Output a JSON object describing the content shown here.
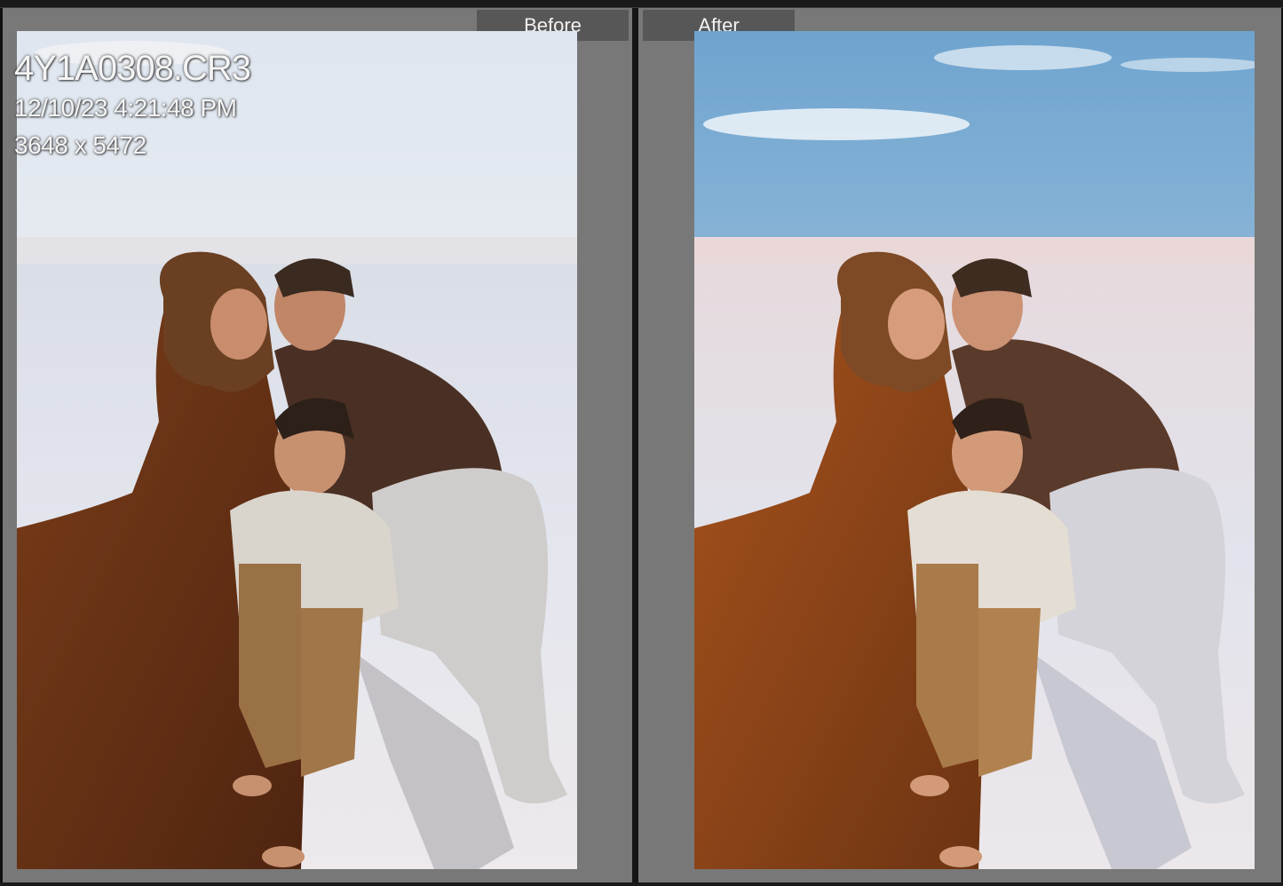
{
  "compare": {
    "before_label": "Before",
    "after_label": "After"
  },
  "photo_info": {
    "filename": "4Y1A0308.CR3",
    "capture_time": "12/10/23 4:21:48 PM",
    "dimensions": "3648 x 5472"
  },
  "colors": {
    "pane_background": "#787878",
    "label_background": "#575757",
    "divider": "#151515"
  }
}
